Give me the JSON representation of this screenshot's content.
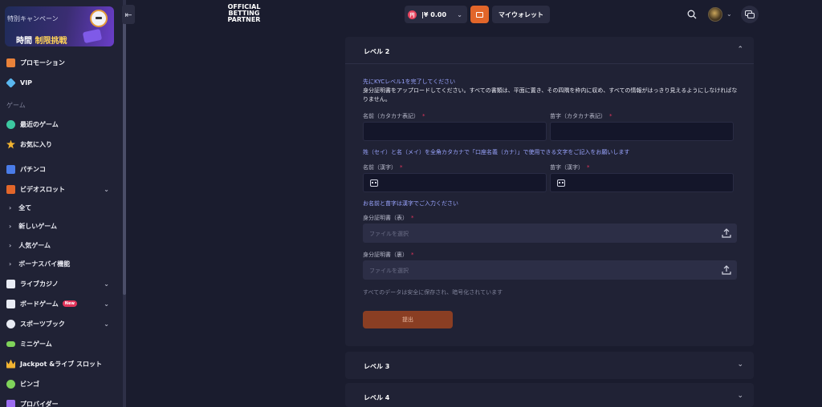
{
  "sidebar": {
    "collapse_icon": "collapse-left-icon",
    "promo": {
      "small": "特別キャンペーン",
      "big_a": "時間 ",
      "big_b": "制限挑戦"
    },
    "items_top": [
      {
        "label": "プロモーション",
        "icon": "gift-icon",
        "color": "#e9823a"
      },
      {
        "label": "VIP",
        "icon": "diamond-icon",
        "color": "#5ab8f0"
      }
    ],
    "section_game": "ゲーム",
    "items_game": [
      {
        "label": "最近のゲーム",
        "icon": "clock-icon",
        "color": "#3cc8a0"
      },
      {
        "label": "お気に入り",
        "icon": "star-icon",
        "color": "#f2b431"
      }
    ],
    "item_pachinko": {
      "label": "パチンコ",
      "icon": "pachinko-icon",
      "color": "#4a7ce8"
    },
    "item_videoslot": {
      "label": "ビデオスロット",
      "icon": "slot-icon",
      "color": "#e2662a",
      "chevron": "⌄"
    },
    "sub_items": [
      "全て",
      "新しいゲーム",
      "人気ゲーム",
      "ボーナスバイ機能"
    ],
    "items_bottom": [
      {
        "label": "ライブカジノ",
        "icon": "cards-icon",
        "color": "#e9ecf5",
        "chevron": "⌄"
      },
      {
        "label": "ボードゲーム",
        "icon": "dice-icon",
        "color": "#e9ecf5",
        "chevron": "⌄",
        "badge": "New"
      },
      {
        "label": "スポーツブック",
        "icon": "ball-icon",
        "color": "#e9ecf5",
        "chevron": "⌄"
      },
      {
        "label": "ミニゲーム",
        "icon": "gamepad-icon",
        "color": "#7fd35a"
      },
      {
        "label": "Jackpot &ライブ スロット",
        "icon": "crown-icon",
        "color": "#f2b431"
      },
      {
        "label": "ビンゴ",
        "icon": "bingo-icon",
        "color": "#7fd35a"
      },
      {
        "label": "プロバイダー",
        "icon": "provider-icon",
        "color": "#9b6cf0"
      }
    ]
  },
  "header": {
    "logo_lines": [
      "OFFICIAL",
      "BETTING",
      "PARTNER"
    ],
    "balance": "¥ 0.00",
    "currency_symbol": "円",
    "my_wallet": "マイウォレット"
  },
  "panel": {
    "title": "レベル 2",
    "kyc_link": "先にKYCレベル1を完了してください",
    "description": "身分証明書をアップロードしてください。すべての書類は、平面に置き、その四隅を枠内に収め、すべての情報がはっきり見えるようにしなければなりません。",
    "first_name_kana_label": "名前（カタカナ表記）",
    "last_name_kana_label": "苗字（カタカナ表記）",
    "kana_hint": "姓（セイ）と名（メイ）を全角カタカナで「口座名義（カナ）」で使用できる文字をご記入をお願いします",
    "first_name_kanji_label": "名前（漢字）",
    "last_name_kanji_label": "苗字（漢字）",
    "kanji_hint": "お名前と苗字は漢字でご入力ください",
    "id_front_label": "身分証明書（表）",
    "id_back_label": "身分証明書（裏）",
    "file_placeholder": "ファイルを選択",
    "secure_note": "すべてのデータは安全に保存され、暗号化されています",
    "submit": "提出",
    "required_mark": "*"
  },
  "accordions": [
    {
      "title": "レベル 3"
    },
    {
      "title": "レベル 4"
    }
  ]
}
